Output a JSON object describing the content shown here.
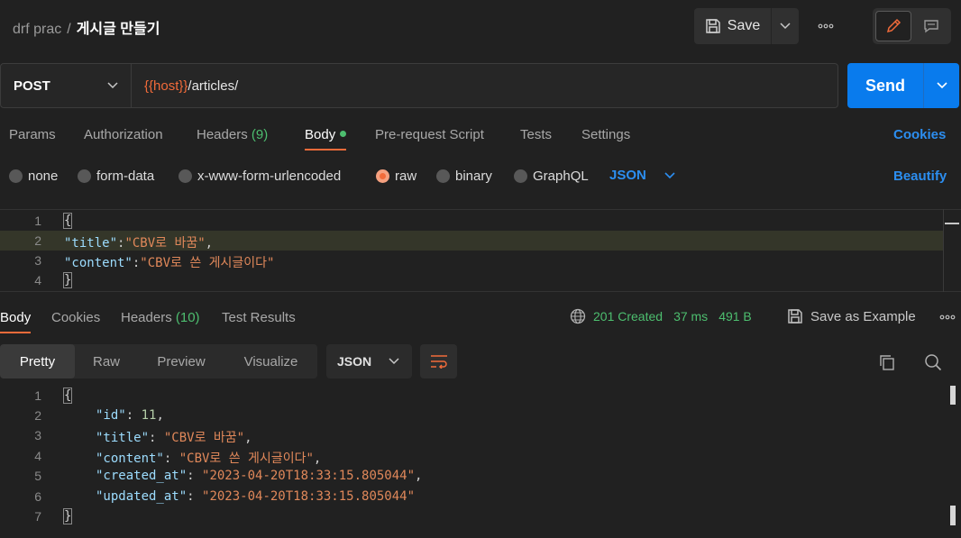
{
  "header": {
    "breadcrumb_parent": "drf prac",
    "breadcrumb_sep": "/",
    "breadcrumb_current": "게시글 만들기",
    "save_label": "Save",
    "more_label": "•••"
  },
  "request": {
    "method": "POST",
    "url_variable": "{{host}}",
    "url_path": "/articles/",
    "send_label": "Send"
  },
  "request_tabs": {
    "params": "Params",
    "authorization": "Authorization",
    "headers": "Headers",
    "headers_count": "(9)",
    "body": "Body",
    "pre_request": "Pre-request Script",
    "tests": "Tests",
    "settings": "Settings",
    "cookies": "Cookies"
  },
  "body_types": {
    "none": "none",
    "form_data": "form-data",
    "urlencoded": "x-www-form-urlencoded",
    "raw": "raw",
    "binary": "binary",
    "graphql": "GraphQL",
    "format": "JSON",
    "beautify": "Beautify"
  },
  "request_body": {
    "line_numbers": [
      "1",
      "2",
      "3",
      "4"
    ],
    "open": "{",
    "close": "}",
    "key1": "\"title\"",
    "val1": "\"CBV로 바꿈\"",
    "key2": "\"content\"",
    "val2": "\"CBV로 쓴 게시글이다\""
  },
  "response_tabs": {
    "body": "Body",
    "cookies": "Cookies",
    "headers": "Headers",
    "headers_count": "(10)",
    "test_results": "Test Results"
  },
  "response_status": {
    "status": "201 Created",
    "time": "37 ms",
    "size": "491 B",
    "save_example": "Save as Example"
  },
  "response_view": {
    "pretty": "Pretty",
    "raw": "Raw",
    "preview": "Preview",
    "visualize": "Visualize",
    "format": "JSON"
  },
  "response_body": {
    "line_numbers": [
      "1",
      "2",
      "3",
      "4",
      "5",
      "6",
      "7"
    ],
    "open": "{",
    "close": "}",
    "id_key": "\"id\"",
    "id_val": "11",
    "title_key": "\"title\"",
    "title_val": "\"CBV로 바꿈\"",
    "content_key": "\"content\"",
    "content_val": "\"CBV로 쓴 게시글이다\"",
    "created_key": "\"created_at\"",
    "created_val": "\"2023-04-20T18:33:15.805044\"",
    "updated_key": "\"updated_at\"",
    "updated_val": "\"2023-04-20T18:33:15.805044\""
  },
  "colors": {
    "accent_orange": "#f26b3a",
    "send_blue": "#097bed",
    "link_blue": "#2c8ef0",
    "status_green": "#4dbe6f",
    "background": "#212121"
  }
}
